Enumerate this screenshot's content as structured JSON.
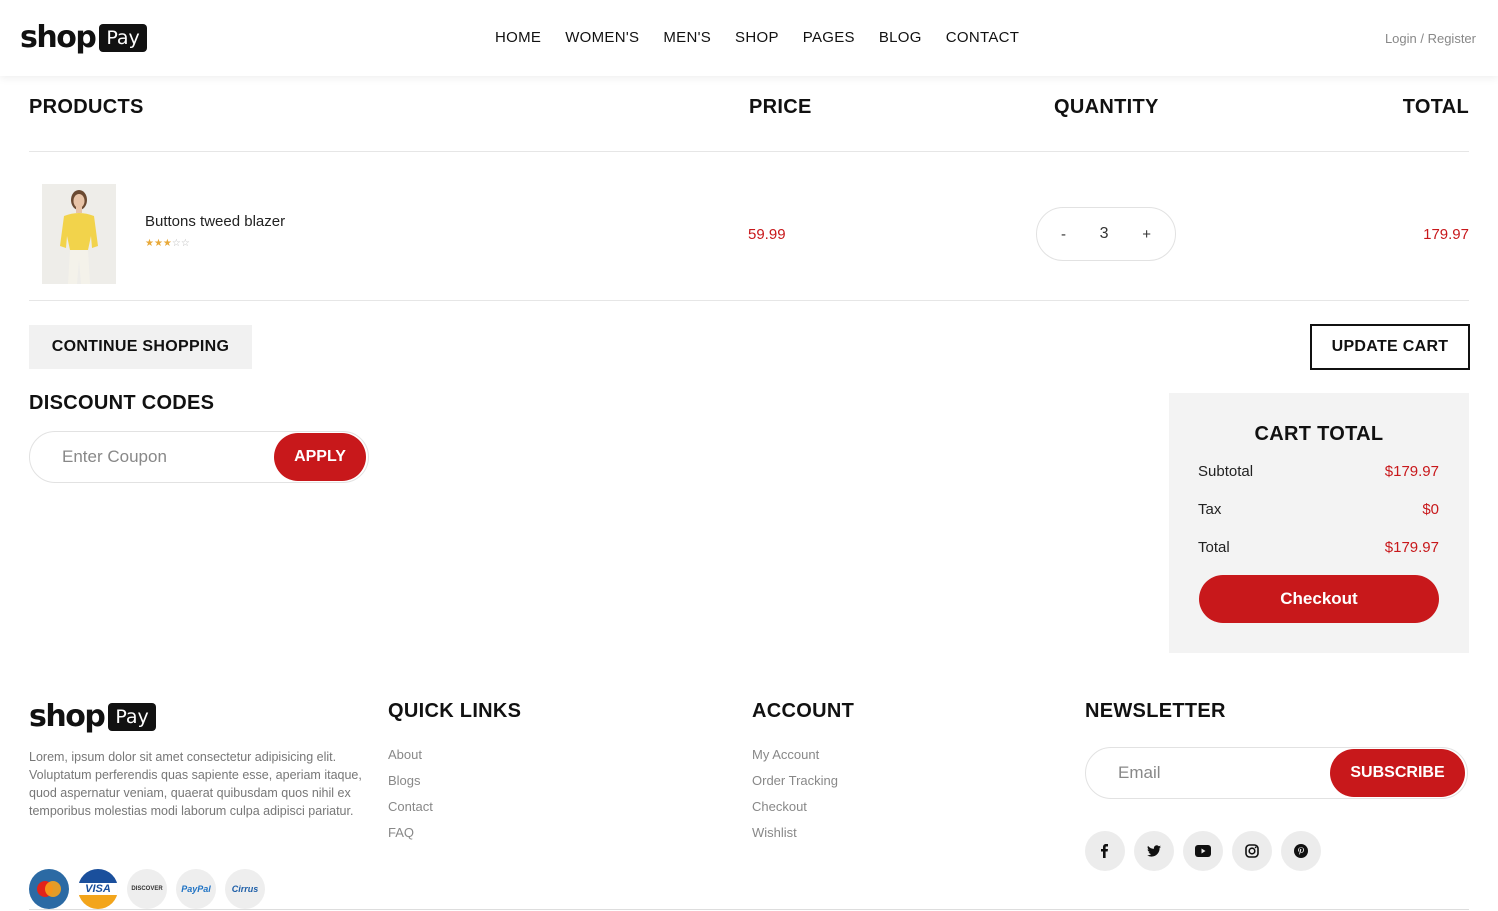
{
  "brand": {
    "logo_word": "shop",
    "logo_badge": "Pay"
  },
  "nav": {
    "items": [
      "HOME",
      "WOMEN'S",
      "MEN'S",
      "SHOP",
      "PAGES",
      "BLOG",
      "CONTACT"
    ]
  },
  "auth": {
    "label": "Login / Register"
  },
  "table": {
    "headers": {
      "products": "PRODUCTS",
      "price": "PRICE",
      "quantity": "QUANTITY",
      "total": "TOTAL"
    }
  },
  "cart_item": {
    "name": "Buttons tweed blazer",
    "rating": 3,
    "rating_max": 5,
    "price": "59.99",
    "quantity": "3",
    "decrement": "-",
    "increment": "+",
    "total": "179.97"
  },
  "actions": {
    "continue": "CONTINUE SHOPPING",
    "update": "UPDATE CART"
  },
  "discount": {
    "title": "DISCOUNT CODES",
    "placeholder": "Enter Coupon",
    "apply": "APPLY"
  },
  "cart_total": {
    "title": "CART TOTAL",
    "subtotal_label": "Subtotal",
    "subtotal": "$179.97",
    "tax_label": "Tax",
    "tax": "$0",
    "total_label": "Total",
    "total": "$179.97",
    "checkout": "Checkout"
  },
  "footer": {
    "about": "Lorem, ipsum dolor sit amet consectetur adipisicing elit. Voluptatum perferendis quas sapiente esse, aperiam itaque, quod aspernatur veniam, quaerat quibusdam quos nihil ex temporibus molestias modi laborum culpa adipisci pariatur.",
    "quick_links": {
      "title": "QUICK LINKS",
      "items": [
        "About",
        "Blogs",
        "Contact",
        "FAQ"
      ]
    },
    "account": {
      "title": "ACCOUNT",
      "items": [
        "My Account",
        "Order Tracking",
        "Checkout",
        "Wishlist"
      ]
    },
    "newsletter": {
      "title": "NEWSLETTER",
      "placeholder": "Email",
      "button": "SUBSCRIBE"
    },
    "socials": [
      "facebook-icon",
      "twitter-icon",
      "youtube-icon",
      "instagram-icon",
      "pinterest-icon"
    ],
    "payments": [
      {
        "label": "MasterCard",
        "bg": "#2b6aa4",
        "fg": "#ffffff"
      },
      {
        "label": "VISA",
        "bg": "#1a4f9c",
        "fg": "#ffffff"
      },
      {
        "label": "DISCOVER",
        "bg": "#eeeeee",
        "fg": "#333333"
      },
      {
        "label": "PayPal",
        "bg": "#eeeeee",
        "fg": "#1e72c4"
      },
      {
        "label": "Cirrus",
        "bg": "#eeeeee",
        "fg": "#1e5fa8"
      }
    ]
  },
  "colors": {
    "accent": "#c8181b",
    "panel": "#f3f3f3",
    "text": "#111111"
  }
}
